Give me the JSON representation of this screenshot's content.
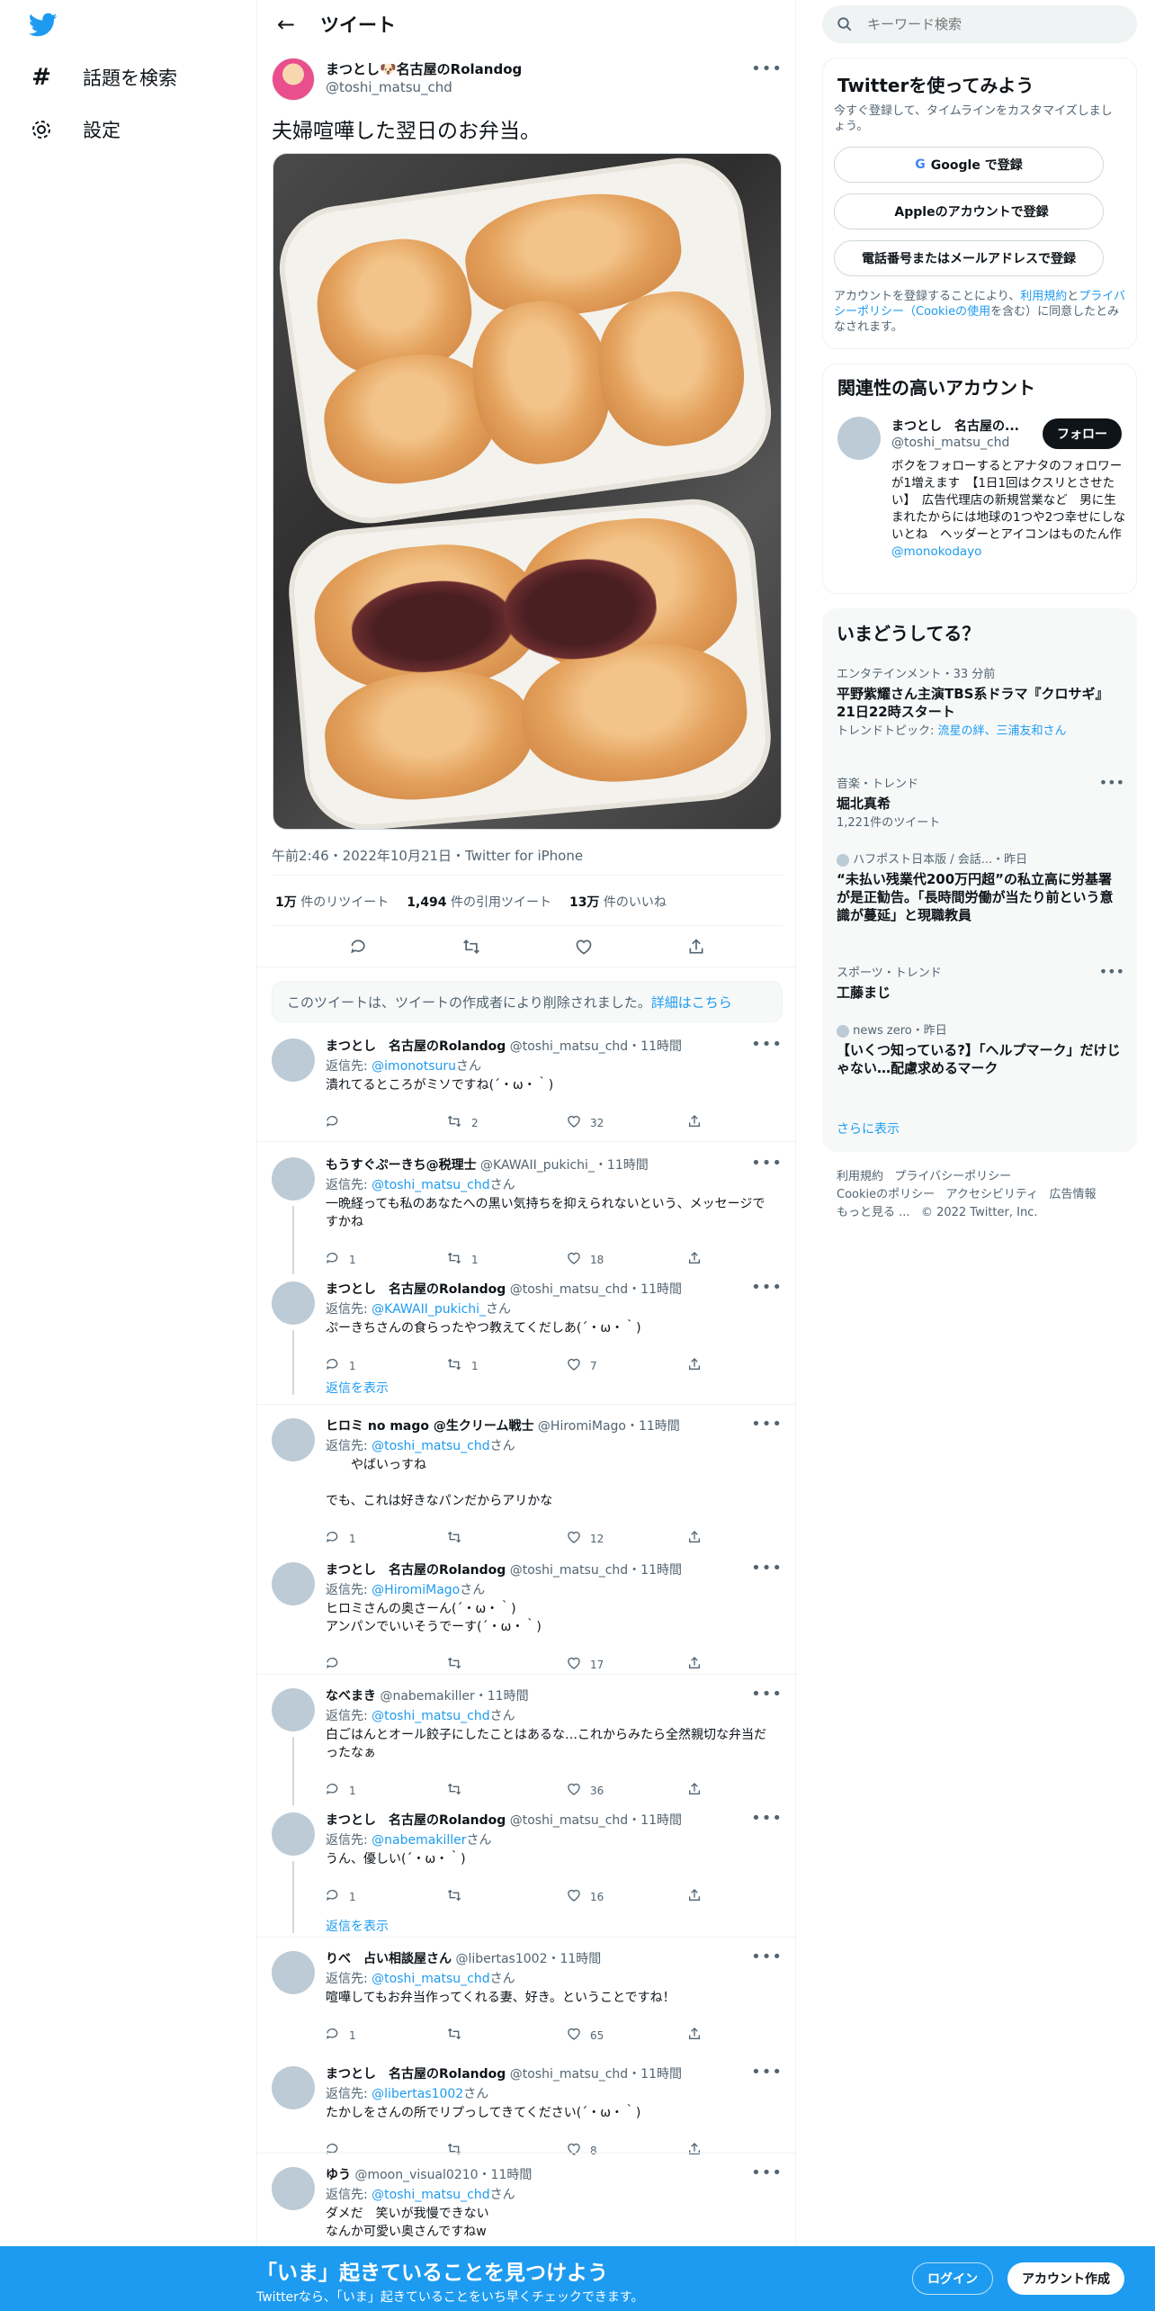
{
  "nav": {
    "explore_label": "話題を検索",
    "settings_label": "設定"
  },
  "header": {
    "title": "ツイート"
  },
  "main_tweet": {
    "name": "まつとし🐶名古屋のRolandog",
    "handle": "@toshi_matsu_chd",
    "text": "夫婦喧嘩した翌日のお弁当。",
    "meta": "午前2:46・2022年10月21日・Twitter for iPhone",
    "retweets_num": "1万",
    "retweets_label": "件のリツイート",
    "quotes_num": "1,494",
    "quotes_label": "件の引用ツイート",
    "likes_num": "13万",
    "likes_label": "件のいいね"
  },
  "deleted_notice": {
    "text": "このツイートは、ツイートの作成者により削除されました。",
    "link": "詳細はこちら"
  },
  "replies": [
    {
      "name": "まつとし　名古屋のRolandog",
      "handle": "@toshi_matsu_chd・11時間",
      "to": "@imonotsuru",
      "body": "潰れてるところがミソですね(´・ω・｀)",
      "reply": "",
      "rt": "2",
      "like": "32"
    },
    {
      "name": "もうすぐぷーきち@税理士",
      "handle": "@KAWAII_pukichi_・11時間",
      "to": "@toshi_matsu_chd",
      "body": "一晩経っても私のあなたへの黒い気持ちを抑えられないという、メッセージですかね",
      "reply": "1",
      "rt": "1",
      "like": "18"
    },
    {
      "name": "まつとし　名古屋のRolandog",
      "handle": "@toshi_matsu_chd・11時間",
      "to": "@KAWAII_pukichi_",
      "body": "ぷーきちさんの食らったやつ教えてくだしあ(´・ω・｀)",
      "reply": "1",
      "rt": "1",
      "like": "7"
    },
    {
      "name": "ヒロミ no mago @生クリーム戦士",
      "handle": "@HiromiMago・11時間",
      "to": "@toshi_matsu_chd",
      "body": "　　やばいっすね\n\nでも、これは好きなパンだからアリかな",
      "reply": "1",
      "rt": "",
      "like": "12"
    },
    {
      "name": "まつとし　名古屋のRolandog",
      "handle": "@toshi_matsu_chd・11時間",
      "to": "@HiromiMago",
      "body": "ヒロミさんの奥さーん(´・ω・｀)\nアンパンでいいそうでーす(´・ω・｀)",
      "reply": "",
      "rt": "",
      "like": "17"
    },
    {
      "name": "なべまき",
      "handle": "@nabemakiller・11時間",
      "to": "@toshi_matsu_chd",
      "body": "白ごはんとオール餃子にしたことはあるな…これからみたら全然親切な弁当だったなぁ",
      "reply": "1",
      "rt": "",
      "like": "36"
    },
    {
      "name": "まつとし　名古屋のRolandog",
      "handle": "@toshi_matsu_chd・11時間",
      "to": "@nabemakiller",
      "body": "うん、優しい(´・ω・｀)",
      "reply": "1",
      "rt": "",
      "like": "16"
    },
    {
      "name": "りべ　占い相談屋さん",
      "handle": "@libertas1002・11時間",
      "to": "@toshi_matsu_chd",
      "body": "喧嘩してもお弁当作ってくれる妻、好き。ということですね！",
      "reply": "1",
      "rt": "",
      "like": "65"
    },
    {
      "name": "まつとし　名古屋のRolandog",
      "handle": "@toshi_matsu_chd・11時間",
      "to": "@libertas1002",
      "body": "たかしをさんの所でリプっしてきてください(´・ω・｀)",
      "reply": "",
      "rt": "",
      "like": "8"
    },
    {
      "name": "ゆう",
      "handle": "@moon_visual0210・11時間",
      "to": "@toshi_matsu_chd",
      "body": "ダメだ　笑いが我慢できない\nなんか可愛い奥さんですねw",
      "reply": "",
      "rt": "",
      "like": ""
    }
  ],
  "reply_prefix": "返信先: ",
  "reply_suffix": "さん",
  "show_replies": "返信を表示",
  "sidebar": {
    "search_placeholder": "キーワード検索",
    "signup_title": "Twitterを使ってみよう",
    "signup_sub": "今すぐ登録して、タイムラインをカスタマイズしましょう。",
    "google_btn": "Google で登録",
    "apple_btn": "Appleのアカウントで登録",
    "phone_btn": "電話番号またはメールアドレスで登録",
    "terms_pre": "アカウントを登録することにより、",
    "terms_link1": "利用規約",
    "terms_mid": "と",
    "terms_link2": "プライバシーポリシー（Cookieの使用",
    "terms_post": "を含む）に同意したとみなされます。",
    "related_title": "関連性の高いアカウント",
    "related_name": "まつとし　名古屋の...",
    "related_handle": "@toshi_matsu_chd",
    "follow_label": "フォロー",
    "related_bio": "ボクをフォローするとアナタのフォロワーが1増えます　【1日1回はクスリとさせたい】　広告代理店の新規営業など　男に生まれたからには地球の1つや2つ幸せにしないとね　ヘッダーとアイコンはものたん作",
    "related_bio_link": "@monokodayo",
    "trends_title": "いまどうしてる？",
    "trends": [
      {
        "meta": "エンタテインメント・33 分前",
        "title": "平野紫耀さん主演TBS系ドラマ『クロサギ』21日22時スタート",
        "sub_pre": "トレンドトピック: ",
        "sub_link": "流星の絆、三浦友和さん"
      },
      {
        "meta": "音楽・トレンド",
        "title": "堀北真希",
        "sub": "1,221件のツイート"
      },
      {
        "meta": "ハフポスト日本版 / 会話...・昨日",
        "title": "“未払い残業代200万円超”の私立高に労基署が是正勧告。「長時間労働が当たり前という意識が蔓延」と現職教員"
      },
      {
        "meta": "スポーツ・トレンド",
        "title": "工藤まじ"
      },
      {
        "meta": "news zero・昨日",
        "title": "【いくつ知っている?】「ヘルプマーク」だけじゃない…配慮求めるマーク"
      }
    ],
    "show_more": "さらに表示",
    "footer": {
      "terms": "利用規約",
      "privacy": "プライバシーポリシー",
      "cookie": "Cookieのポリシー",
      "access": "アクセシビリティ",
      "ads": "広告情報",
      "more": "もっと見る ...",
      "copy": "© 2022 Twitter, Inc."
    }
  },
  "bottombar": {
    "title": "「いま」起きていることを見つけよう",
    "sub": "Twitterなら、「いま」起きていることをいち早くチェックできます。",
    "login": "ログイン",
    "signup": "アカウント作成"
  }
}
